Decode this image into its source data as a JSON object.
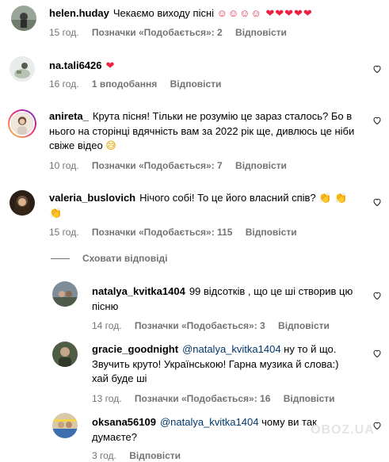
{
  "comments": [
    {
      "username": "helen.huday",
      "text": "Чекаємо виходу пісні ",
      "emoji": "☺☺☺☺ ❤❤❤❤❤",
      "time": "15 год.",
      "likes": "Позначки «Подобається»: 2",
      "reply": "Відповісти"
    },
    {
      "username": "na.tali6426",
      "text": "",
      "emoji": "❤",
      "time": "16 год.",
      "likes": "1 вподобання",
      "reply": "Відповісти"
    },
    {
      "username": "anireta_",
      "text": "Крута пісня! Тільки не розумію це зараз сталось? Бо в нього на сторінці вдячність вам за 2022 рік ще, дивлюсь це ніби свіже відео ",
      "emoji": "😅",
      "time": "10 год.",
      "likes": "Позначки «Подобається»: 7",
      "reply": "Відповісти"
    },
    {
      "username": "valeria_buslovich",
      "text": "Нічого собі! То це його власний спів? ",
      "emoji": "👏 👏👏",
      "time": "15 год.",
      "likes": "Позначки «Подобається»: 115",
      "reply": "Відповісти"
    }
  ],
  "hide_replies": "Сховати відповіді",
  "replies": [
    {
      "username": "natalya_kvitka1404",
      "mention": "",
      "text": "99 відсотків , що це ші створив цю пісню",
      "time": "14 год.",
      "likes": "Позначки «Подобається»: 3",
      "reply": "Відповісти"
    },
    {
      "username": "gracie_goodnight",
      "mention": "@natalya_kvitka1404",
      "text": " ну то й що. Звучить круто! Українською! Гарна музика й слова:) хай буде ші",
      "time": "13 год.",
      "likes": "Позначки «Подобається»: 16",
      "reply": "Відповісти"
    },
    {
      "username": "oksana56109",
      "mention": "@natalya_kvitka1404",
      "text": " чому ви так думаєте?",
      "time": "3 год.",
      "likes": "",
      "reply": "Відповісти"
    }
  ],
  "watermark": "OBOZ.UA",
  "colors": {
    "meta": "#737373",
    "mention": "#00376b",
    "heart": "#ed2040"
  },
  "icons": {
    "like": "heart-outline-icon"
  }
}
